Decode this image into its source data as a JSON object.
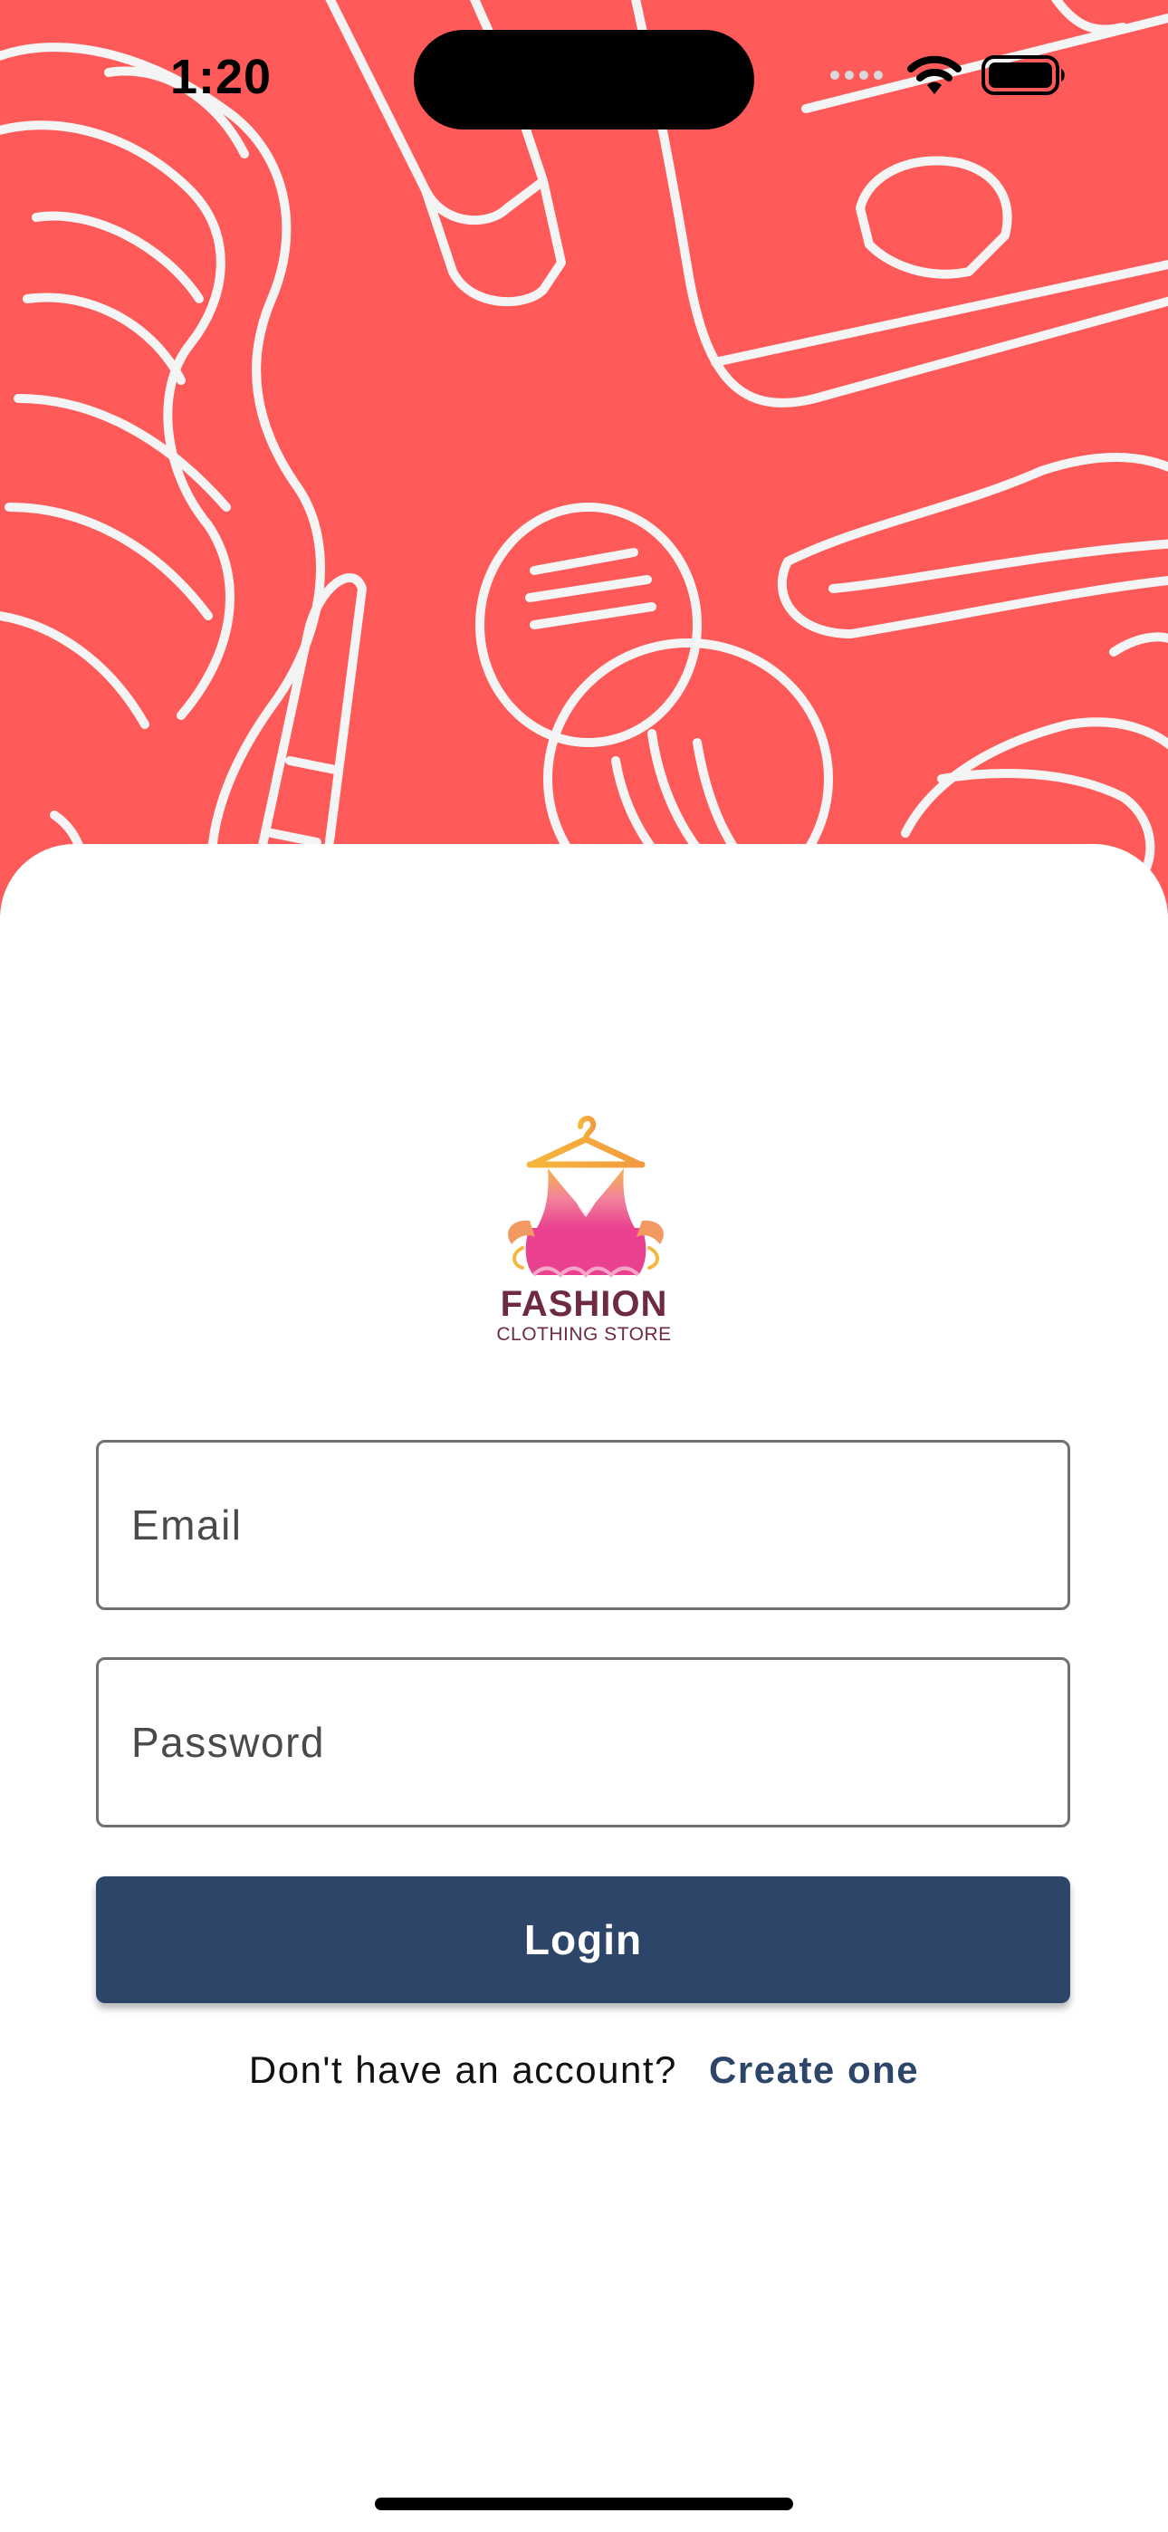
{
  "status_bar": {
    "time": "1:20"
  },
  "logo": {
    "title": "FASHION",
    "subtitle": "CLOTHING STORE"
  },
  "form": {
    "email_placeholder": "Email",
    "email_value": "",
    "password_placeholder": "Password",
    "password_value": ""
  },
  "login_button": {
    "label": "Login"
  },
  "signup": {
    "prompt": "Don't have an account?",
    "link": "Create one"
  },
  "colors": {
    "hero_background": "#fd5a59",
    "primary": "#2d4568",
    "logo_text": "#6e2b40"
  },
  "icons": [
    "signal-icon",
    "wifi-icon",
    "battery-icon",
    "hanger-dress-logo-icon"
  ]
}
